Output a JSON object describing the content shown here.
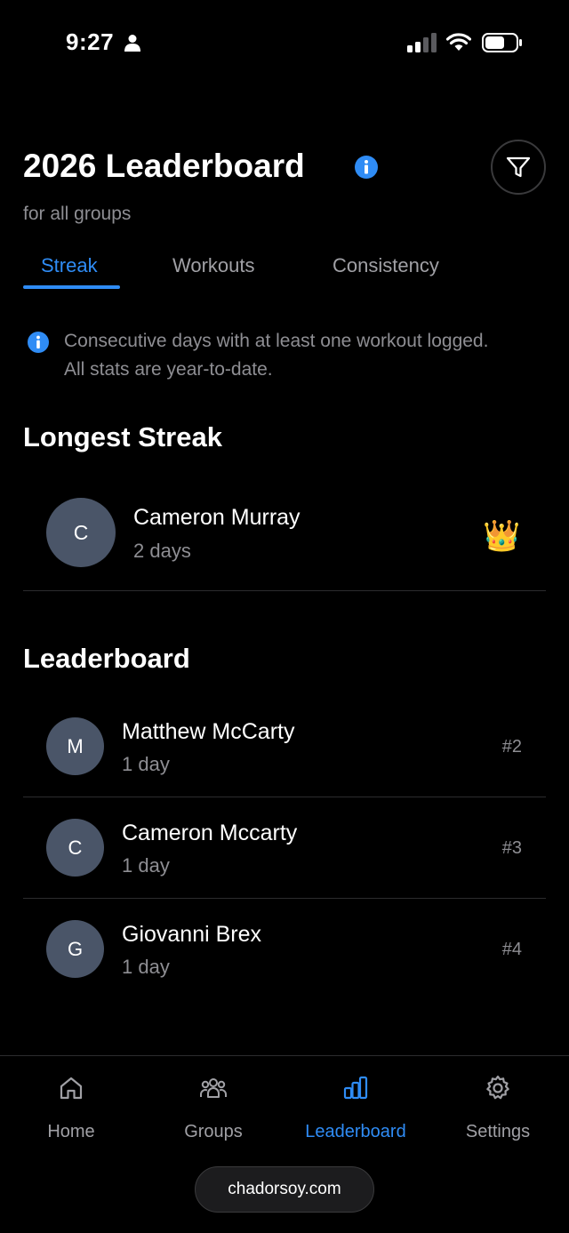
{
  "status_bar": {
    "time": "9:27"
  },
  "header": {
    "title": "2026 Leaderboard",
    "subtitle": "for all groups"
  },
  "tabs": [
    {
      "label": "Streak",
      "active": true
    },
    {
      "label": "Workouts",
      "active": false
    },
    {
      "label": "Consistency",
      "active": false
    }
  ],
  "info_note": {
    "line1": "Consecutive days with at least one workout logged.",
    "line2": "All stats are year-to-date."
  },
  "longest_streak": {
    "title": "Longest Streak",
    "entry": {
      "initial": "C",
      "name": "Cameron Murray",
      "value": "2 days",
      "badge": "👑"
    }
  },
  "leaderboard": {
    "title": "Leaderboard",
    "entries": [
      {
        "initial": "M",
        "name": "Matthew McCarty",
        "value": "1 day",
        "rank": "#2"
      },
      {
        "initial": "C",
        "name": "Cameron Mccarty",
        "value": "1 day",
        "rank": "#3"
      },
      {
        "initial": "G",
        "name": "Giovanni Brex",
        "value": "1 day",
        "rank": "#4"
      }
    ]
  },
  "nav": [
    {
      "label": "Home",
      "icon": "home-icon",
      "active": false
    },
    {
      "label": "Groups",
      "icon": "groups-icon",
      "active": false
    },
    {
      "label": "Leaderboard",
      "icon": "leaderboard-icon",
      "active": true
    },
    {
      "label": "Settings",
      "icon": "gear-icon",
      "active": false
    }
  ],
  "browser": {
    "url": "chadorsoy.com"
  },
  "colors": {
    "accent": "#2f8cf5",
    "background": "#000000",
    "avatar": "#4a5568",
    "muted": "#8e8e93"
  }
}
